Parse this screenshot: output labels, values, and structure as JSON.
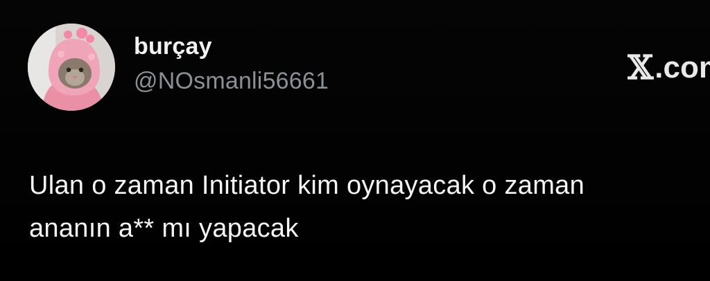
{
  "tweet": {
    "display_name": "burçay",
    "handle": "@NOsmanli56661",
    "lines": [
      "Ulan o zaman Initiator kim oynayacak o zaman",
      "ananın a** mı yapacak"
    ]
  },
  "brand": {
    "x_glyph": "𝕏",
    "domain_text": ".com"
  },
  "avatar": {
    "icon": "cat-in-pink-costume",
    "colors": {
      "costume": "#f0a4b8",
      "background": "#d9d4d1"
    }
  },
  "theme": {
    "background": "#000000",
    "name_color": "#f2f2f2",
    "handle_color": "#8b9096",
    "text_color": "#f5f5f5"
  }
}
